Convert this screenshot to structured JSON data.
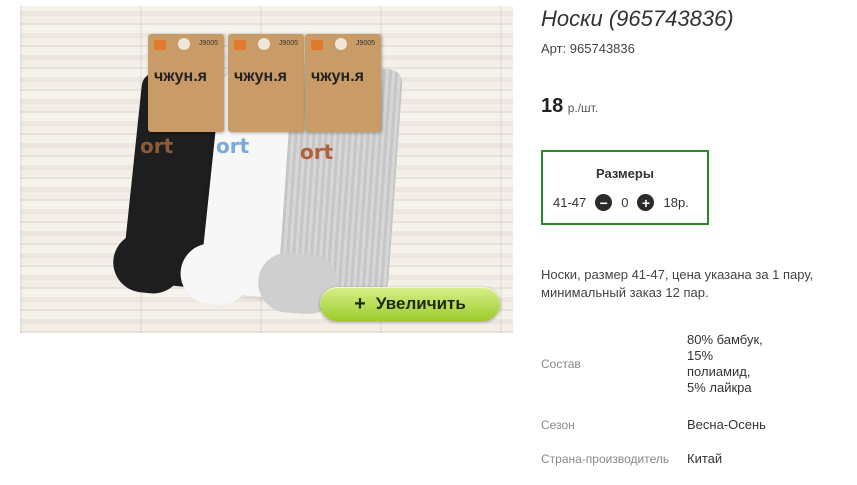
{
  "product": {
    "title": "Носки (965743836)",
    "article": "Арт: 965743836",
    "price_amount": "18",
    "price_unit": "р./шт."
  },
  "photo": {
    "tag_code": "J9005",
    "tag_brand": "чжун.я",
    "sock_text": "ort",
    "zoom_button": {
      "icon": "+",
      "label": "Увеличить"
    }
  },
  "sizes_box": {
    "title": "Размеры",
    "size": "41-47",
    "quantity": "0",
    "price": "18р.",
    "border_color": "#2a8a2a"
  },
  "description": "Носки, размер 41-47, цена указана за 1 пару, минимальный заказ 12 пар.",
  "properties": [
    {
      "key": "Состав",
      "value": "80% бамбук, 15% полиамид, 5% лайкра"
    },
    {
      "key": "Сезон",
      "value": "Весна-Осень"
    },
    {
      "key": "Страна-производитель",
      "value": "Китай"
    }
  ],
  "colors": {
    "zoom_button": "#9ccb2a",
    "sizes_border": "#2a8a2a"
  }
}
